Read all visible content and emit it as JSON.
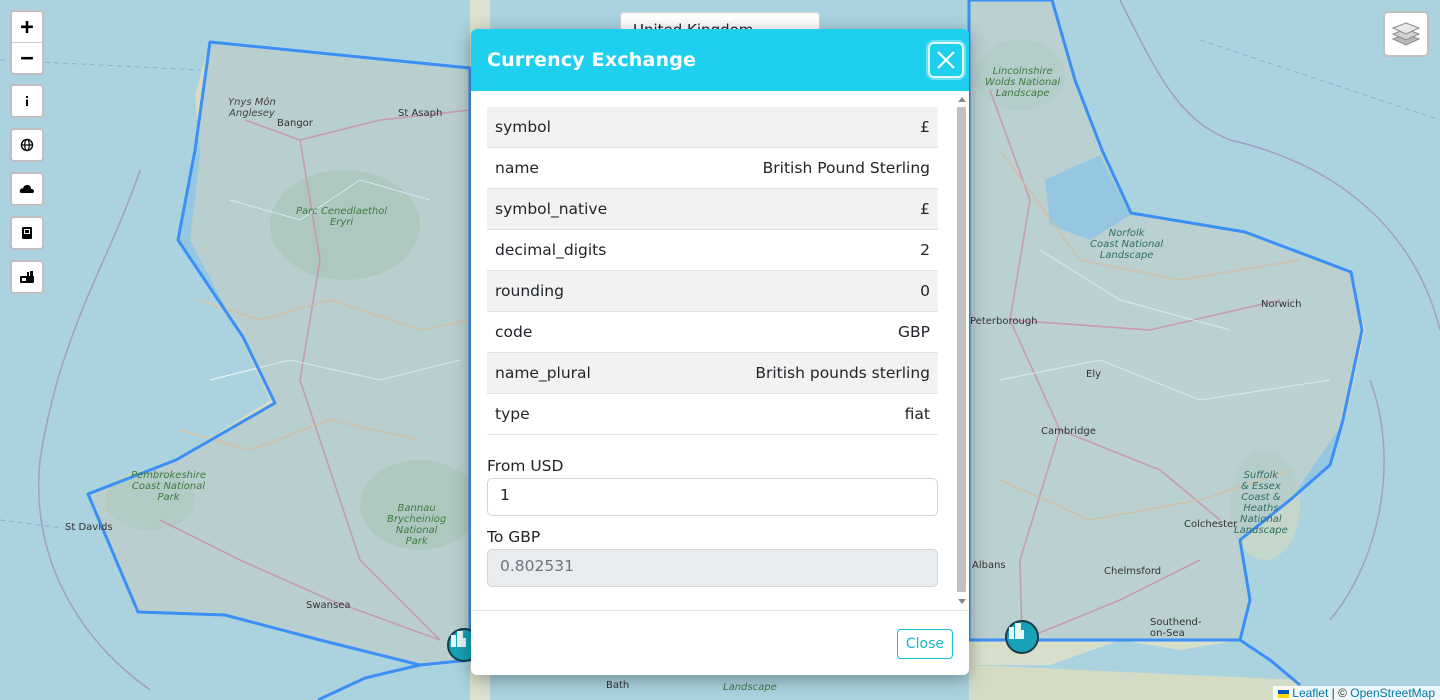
{
  "country_select": {
    "value": "United Kingdom"
  },
  "map": {
    "places": [
      {
        "key": "ynys",
        "text": "Ynys Môn\nAnglesey",
        "kind": "island"
      },
      {
        "key": "bangor",
        "text": "Bangor",
        "kind": "town"
      },
      {
        "key": "stasaph",
        "text": "St Asaph",
        "kind": "town"
      },
      {
        "key": "eryri",
        "text": "Parc Cenedlaethol\nEryri",
        "kind": "park"
      },
      {
        "key": "pembs",
        "text": "Pembrokeshire\nCoast National\nPark",
        "kind": "park"
      },
      {
        "key": "stdavids",
        "text": "St Davids",
        "kind": "town"
      },
      {
        "key": "bannau",
        "text": "Bannau\nBrycheiniog\nNational\nPark",
        "kind": "park"
      },
      {
        "key": "swansea",
        "text": "Swansea",
        "kind": "town"
      },
      {
        "key": "lincs",
        "text": "Lincolnshire\nWolds National\nLandscape",
        "kind": "park"
      },
      {
        "key": "norfolkcoast",
        "text": "Norfolk\nCoast National\nLandscape",
        "kind": "coast"
      },
      {
        "key": "norwich",
        "text": "Norwich",
        "kind": "town"
      },
      {
        "key": "peterborough",
        "text": "Peterborough",
        "kind": "town"
      },
      {
        "key": "ely",
        "text": "Ely",
        "kind": "town"
      },
      {
        "key": "cambridge",
        "text": "Cambridge",
        "kind": "town"
      },
      {
        "key": "suffolk",
        "text": "Suffolk\n& Essex\nCoast &\nHeaths\nNational\nLandscape",
        "kind": "coast"
      },
      {
        "key": "colchester",
        "text": "Colchester",
        "kind": "town"
      },
      {
        "key": "chelmsford",
        "text": "Chelmsford",
        "kind": "town"
      },
      {
        "key": "albans",
        "text": "Albans",
        "kind": "town"
      },
      {
        "key": "southend",
        "text": "Southend-\non-Sea",
        "kind": "town"
      },
      {
        "key": "bath",
        "text": "Bath",
        "kind": "town"
      },
      {
        "key": "landscape",
        "text": "Landscape",
        "kind": "park"
      }
    ],
    "attribution": {
      "leaflet": "Leaflet",
      "separator": " | © ",
      "osm": "OpenStreetMap"
    }
  },
  "controls": {
    "zoom_in": "+",
    "zoom_out": "−",
    "buttons": [
      {
        "name": "info-button",
        "icon": "info-icon"
      },
      {
        "name": "globe-button",
        "icon": "globe-icon"
      },
      {
        "name": "weather-button",
        "icon": "cloud-icon"
      },
      {
        "name": "wikipedia-button",
        "icon": "book-icon"
      },
      {
        "name": "news-button",
        "icon": "news-icon"
      }
    ],
    "layers_icon": "layers-icon"
  },
  "modal": {
    "title": "Currency Exchange",
    "rows": [
      {
        "key": "symbol",
        "value": "£"
      },
      {
        "key": "name",
        "value": "British Pound Sterling"
      },
      {
        "key": "symbol_native",
        "value": "£"
      },
      {
        "key": "decimal_digits",
        "value": "2"
      },
      {
        "key": "rounding",
        "value": "0"
      },
      {
        "key": "code",
        "value": "GBP"
      },
      {
        "key": "name_plural",
        "value": "British pounds sterling"
      },
      {
        "key": "type",
        "value": "fiat"
      }
    ],
    "from_label": "From USD",
    "from_value": "1",
    "to_label": "To GBP",
    "to_value": "0.802531",
    "close_label": "Close"
  },
  "colors": {
    "header": "#1ed0ee",
    "border_line": "#3b8ff5",
    "sea": "#aad3df",
    "land": "#d6dfc9"
  }
}
